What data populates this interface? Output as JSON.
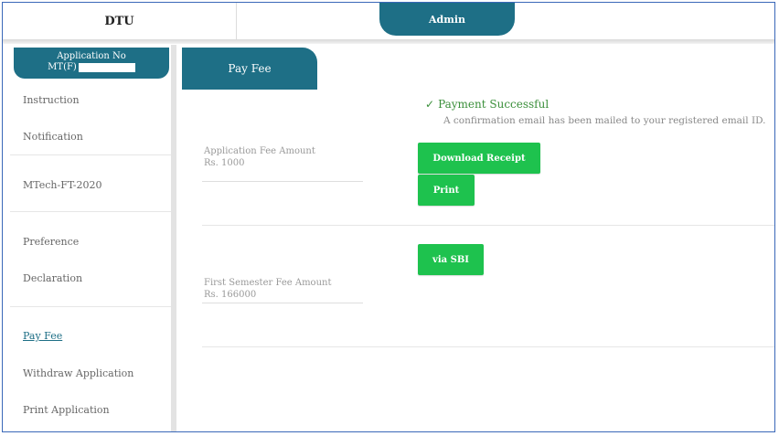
{
  "header": {
    "brand": "DTU",
    "admin_tab": "Admin"
  },
  "sidebar": {
    "app_no_label": "Application No",
    "app_no_prefix": "MT(F)",
    "items": [
      {
        "label": "Instruction",
        "active": false
      },
      {
        "label": "Notification",
        "active": false
      },
      {
        "label": "MTech-FT-2020",
        "active": false
      },
      {
        "label": "Preference",
        "active": false
      },
      {
        "label": "Declaration",
        "active": false
      },
      {
        "label": "Pay Fee",
        "active": true
      },
      {
        "label": "Withdraw Application",
        "active": false
      },
      {
        "label": "Print Application",
        "active": false
      }
    ]
  },
  "main": {
    "tab": "Pay Fee",
    "status": {
      "title": "Payment Successful",
      "message": "A confirmation email has been mailed to your registered email ID."
    },
    "application_fee": {
      "label": "Application Fee Amount",
      "amount": "Rs. 1000"
    },
    "semester_fee": {
      "label": "First Semester Fee Amount",
      "amount": "Rs. 166000"
    },
    "buttons": {
      "download_receipt": "Download Receipt",
      "print": "Print",
      "via_sbi": "via SBI"
    }
  },
  "colors": {
    "primary": "#1e6f86",
    "success_button": "#1ec24e",
    "success_text": "#3a8f3a",
    "frame_border": "#3a68b8"
  }
}
